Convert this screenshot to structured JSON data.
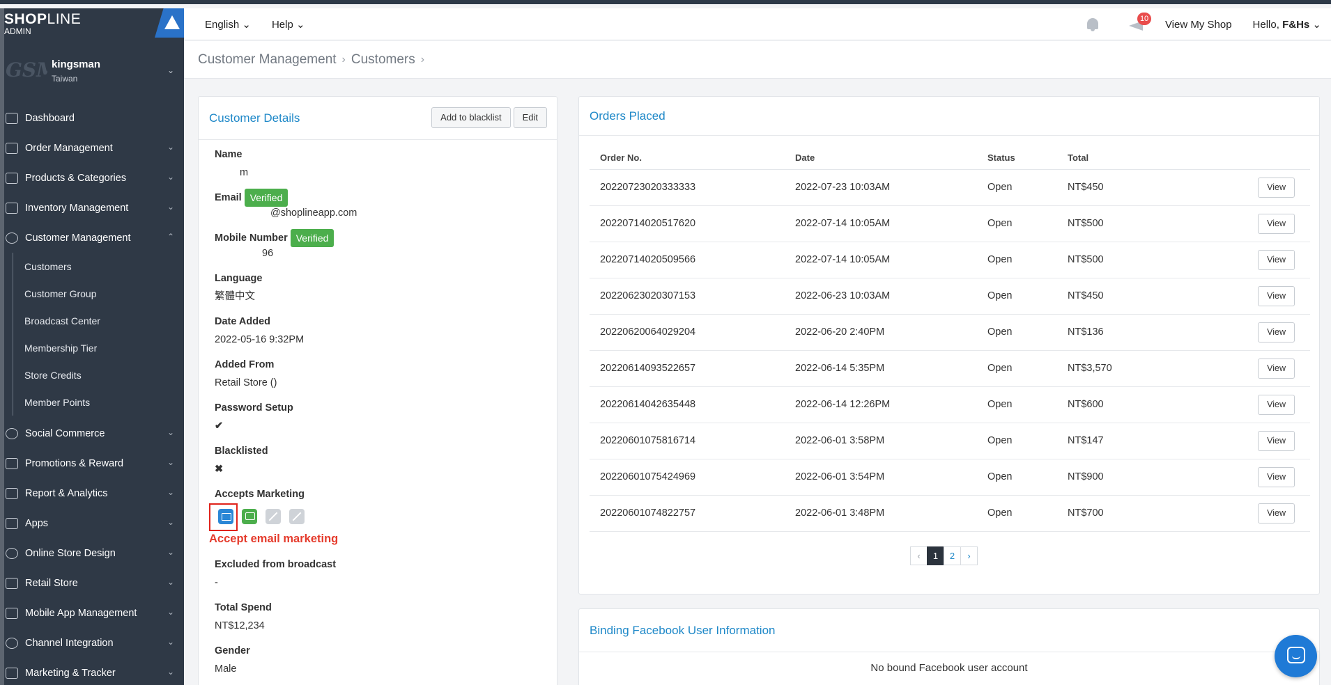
{
  "brand": {
    "name_bold": "SHOP",
    "name_light": "LINE",
    "sub": "ADMIN"
  },
  "store": {
    "avatar_text": "GSM",
    "name": "kingsman",
    "region": "Taiwan"
  },
  "sidebar": {
    "items": [
      {
        "label": "Dashboard",
        "icon": "dashboard-icon"
      },
      {
        "label": "Order Management",
        "icon": "order-icon"
      },
      {
        "label": "Products & Categories",
        "icon": "bag-icon"
      },
      {
        "label": "Inventory Management",
        "icon": "inventory-icon"
      },
      {
        "label": "Customer Management",
        "icon": "user-icon"
      }
    ],
    "sub_items": [
      "Customers",
      "Customer Group",
      "Broadcast Center",
      "Membership Tier",
      "Store Credits",
      "Member Points"
    ],
    "items_after": [
      {
        "label": "Social Commerce",
        "icon": "chat-icon"
      },
      {
        "label": "Promotions & Reward",
        "icon": "tag-icon"
      },
      {
        "label": "Report & Analytics",
        "icon": "chart-icon"
      },
      {
        "label": "Apps",
        "icon": "apps-icon"
      },
      {
        "label": "Online Store Design",
        "icon": "palette-icon"
      },
      {
        "label": "Retail Store",
        "icon": "store-icon"
      },
      {
        "label": "Mobile App Management",
        "icon": "mobile-icon"
      },
      {
        "label": "Channel Integration",
        "icon": "globe-icon"
      },
      {
        "label": "Marketing & Tracker",
        "icon": "megaphone-icon"
      }
    ]
  },
  "topbar": {
    "language": "English",
    "help": "Help",
    "notification_count": "10",
    "view_shop": "View My Shop",
    "hello_prefix": "Hello,",
    "user": "F&Hs"
  },
  "breadcrumb": {
    "parent": "Customer Management",
    "current": "Customers"
  },
  "details": {
    "title": "Customer Details",
    "blacklist_button": "Add to blacklist",
    "edit_button": "Edit",
    "name_label": "Name",
    "name_value": "m",
    "email_label": "Email",
    "verified": "Verified",
    "email_value": "@shoplineapp.com",
    "mobile_label": "Mobile Number",
    "mobile_value": "96",
    "language_label": "Language",
    "language_value": "繁體中文",
    "date_added_label": "Date Added",
    "date_added_value": "2022-05-16 9:32PM",
    "added_from_label": "Added From",
    "added_from_value": "Retail Store ()",
    "password_label": "Password Setup",
    "blacklisted_label": "Blacklisted",
    "marketing_label": "Accepts Marketing",
    "annotation": "Accept email marketing",
    "excluded_label": "Excluded from broadcast",
    "excluded_value": "-",
    "spend_label": "Total Spend",
    "spend_value": "NT$12,234",
    "gender_label": "Gender",
    "gender_value": "Male"
  },
  "orders": {
    "title": "Orders Placed",
    "columns": {
      "order_no": "Order No.",
      "date": "Date",
      "status": "Status",
      "total": "Total"
    },
    "view_label": "View",
    "rows": [
      {
        "order_no": "20220723020333333",
        "date": "2022-07-23 10:03AM",
        "status": "Open",
        "total": "NT$450"
      },
      {
        "order_no": "20220714020517620",
        "date": "2022-07-14 10:05AM",
        "status": "Open",
        "total": "NT$500"
      },
      {
        "order_no": "20220714020509566",
        "date": "2022-07-14 10:05AM",
        "status": "Open",
        "total": "NT$500"
      },
      {
        "order_no": "20220623020307153",
        "date": "2022-06-23 10:03AM",
        "status": "Open",
        "total": "NT$450"
      },
      {
        "order_no": "20220620064029204",
        "date": "2022-06-20 2:40PM",
        "status": "Open",
        "total": "NT$136"
      },
      {
        "order_no": "20220614093522657",
        "date": "2022-06-14 5:35PM",
        "status": "Open",
        "total": "NT$3,570"
      },
      {
        "order_no": "20220614042635448",
        "date": "2022-06-14 12:26PM",
        "status": "Open",
        "total": "NT$600"
      },
      {
        "order_no": "20220601075816714",
        "date": "2022-06-01 3:58PM",
        "status": "Open",
        "total": "NT$147"
      },
      {
        "order_no": "20220601075424969",
        "date": "2022-06-01 3:54PM",
        "status": "Open",
        "total": "NT$900"
      },
      {
        "order_no": "20220601074822757",
        "date": "2022-06-01 3:48PM",
        "status": "Open",
        "total": "NT$700"
      }
    ],
    "pagination": {
      "prev": "‹",
      "pages": [
        "1",
        "2"
      ],
      "next": "›",
      "current": "1"
    }
  },
  "facebook": {
    "title": "Binding Facebook User Information",
    "empty": "No bound Facebook user account"
  }
}
